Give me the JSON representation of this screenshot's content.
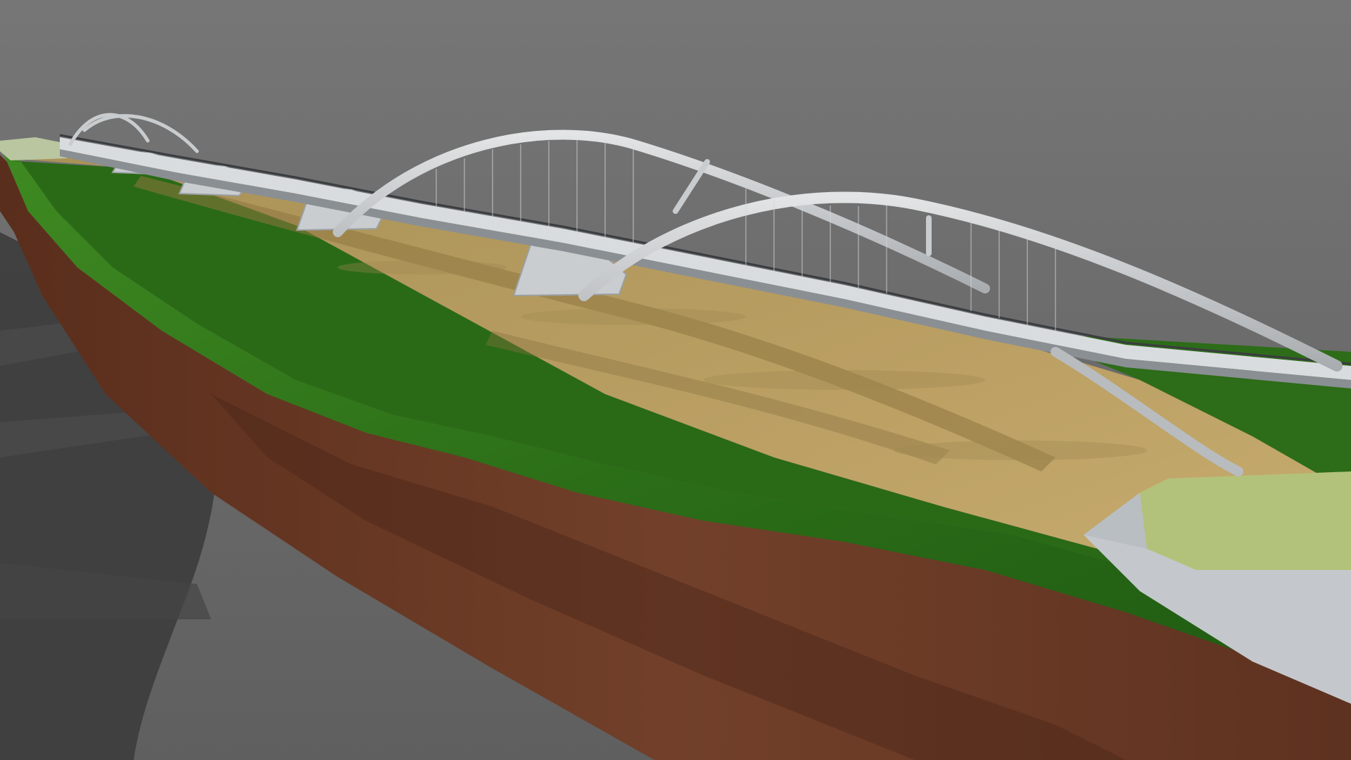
{
  "scene": {
    "subject": "bridge-render",
    "colors": {
      "background": "#6e6e6e",
      "shadow": "#3f3f3f",
      "grass": "#2f7a1e",
      "grass_dark": "#1f5a12",
      "riverbed": "#b59a5c",
      "riverbed_light": "#c7ad6f",
      "soil": "#6a3a24",
      "soil_dark": "#4a2416",
      "concrete": "#cfd3d6",
      "concrete_shade": "#9aa0a4",
      "arch": "#c9ccce",
      "deck": "#d9dcde",
      "railing": "#3a3d40"
    }
  }
}
